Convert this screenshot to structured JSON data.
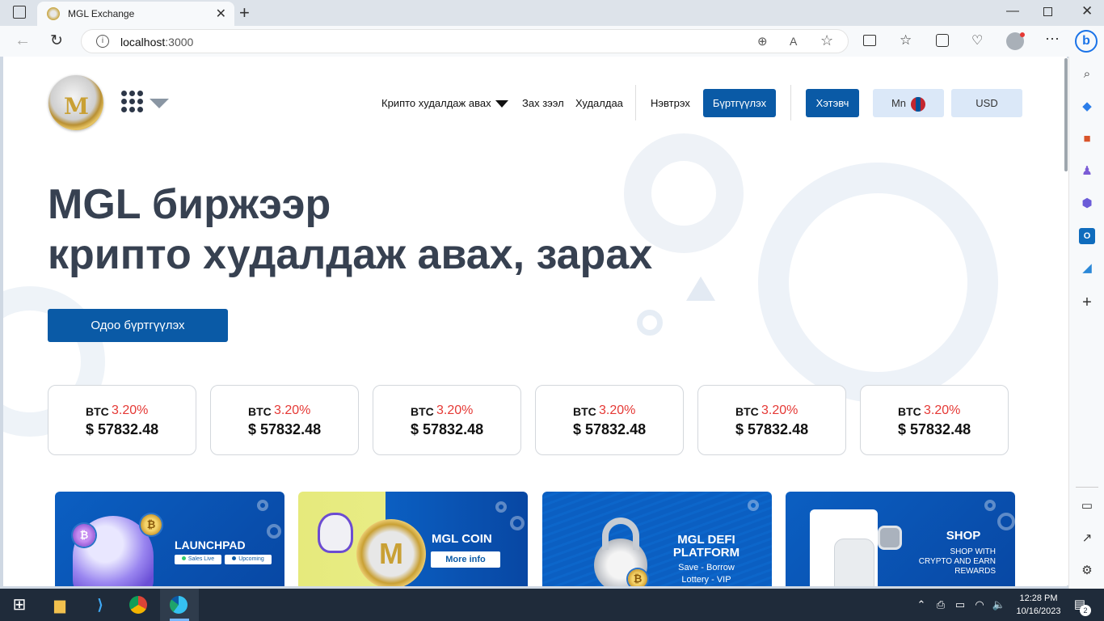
{
  "browser": {
    "tab_title": "MGL Exchange",
    "tab_close": "✕",
    "new_tab": "+",
    "url_host": "localhost",
    "url_port": ":3000"
  },
  "header": {
    "nav_buy_crypto": "Крипто худалдаж авах",
    "nav_market": "Зах зээл",
    "nav_trade": "Худалдаа",
    "login": "Нэвтрэх",
    "register": "Бүртгүүлэх",
    "wallet": "Хэтэвч",
    "language": "Mn",
    "currency": "USD"
  },
  "hero": {
    "line1": "MGL биржээр",
    "line2": "крипто худалдаж авах, зарах",
    "cta": "Одоо бүртгүүлэх"
  },
  "tickers": [
    {
      "symbol": "BTC",
      "change": "3.20%",
      "price": "$ 57832.48"
    },
    {
      "symbol": "BTC",
      "change": "3.20%",
      "price": "$ 57832.48"
    },
    {
      "symbol": "BTC",
      "change": "3.20%",
      "price": "$ 57832.48"
    },
    {
      "symbol": "BTC",
      "change": "3.20%",
      "price": "$ 57832.48"
    },
    {
      "symbol": "BTC",
      "change": "3.20%",
      "price": "$ 57832.48"
    },
    {
      "symbol": "BTC",
      "change": "3.20%",
      "price": "$ 57832.48"
    }
  ],
  "banners": {
    "launchpad": {
      "title": "LAUNCHPAD",
      "tag1": "Sales Live",
      "tag2": "Upcoming"
    },
    "mglcoin": {
      "title": "MGL COIN",
      "button": "More info"
    },
    "defi": {
      "title1": "MGL DEFI",
      "title2": "PLATFORM",
      "sub1": "Save - Borrow",
      "sub2": "Lottery - VIP"
    },
    "shop": {
      "title": "SHOP",
      "sub1": "SHOP WITH",
      "sub2": "CRYPTO AND EARN",
      "sub3": "REWARDS"
    }
  },
  "taskbar": {
    "time": "12:28 PM",
    "date": "10/16/2023",
    "notifications": "2"
  },
  "colors": {
    "primary": "#0a5aa6",
    "light_button": "#dbe8f8",
    "change_red": "#e53935",
    "hero_text": "#374151"
  }
}
